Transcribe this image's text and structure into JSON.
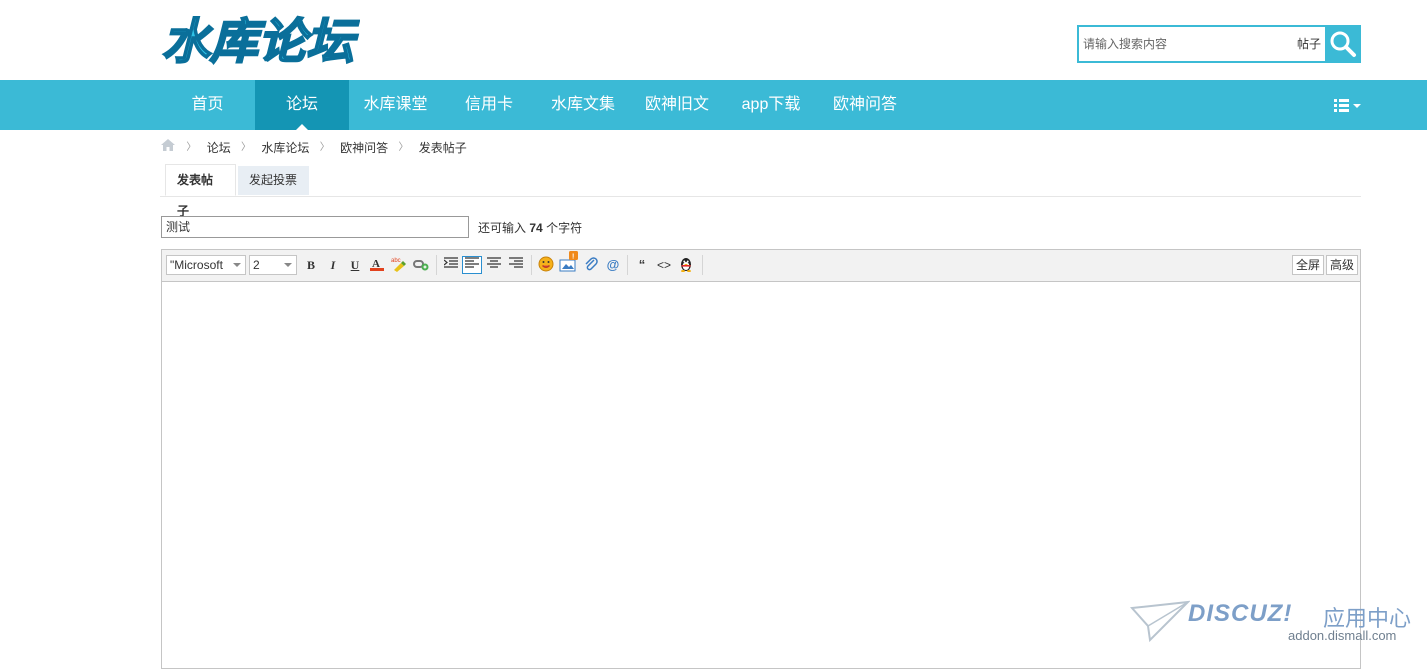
{
  "header": {
    "logo_text": "水库论坛",
    "search_placeholder": "请输入搜索内容",
    "search_type": "帖子"
  },
  "nav": {
    "items": [
      {
        "label": "首页"
      },
      {
        "label": "论坛"
      },
      {
        "label": "水库课堂"
      },
      {
        "label": "信用卡"
      },
      {
        "label": "水库文集"
      },
      {
        "label": "欧神旧文"
      },
      {
        "label": "app下载"
      },
      {
        "label": "欧神问答"
      }
    ],
    "active_index": 1
  },
  "breadcrumb": [
    "论坛",
    "水库论坛",
    "欧神问答",
    "发表帖子"
  ],
  "tabs": {
    "post": "发表帖子",
    "poll": "发起投票"
  },
  "subject": {
    "value": "测试",
    "remain_prefix": "还可输入",
    "remain_count": "74",
    "remain_suffix": "个字符"
  },
  "toolbar": {
    "font": "\"Microsoft",
    "size": "2",
    "bold": "B",
    "italic": "I",
    "underline": "U",
    "fullscreen": "全屏",
    "advanced": "高级"
  },
  "watermark": {
    "brand": "DISCUZ!",
    "suffix": "应用中心",
    "url": "addon.dismall.com"
  },
  "colors": {
    "accent": "#3bbad6",
    "nav_active": "#1495b4"
  }
}
